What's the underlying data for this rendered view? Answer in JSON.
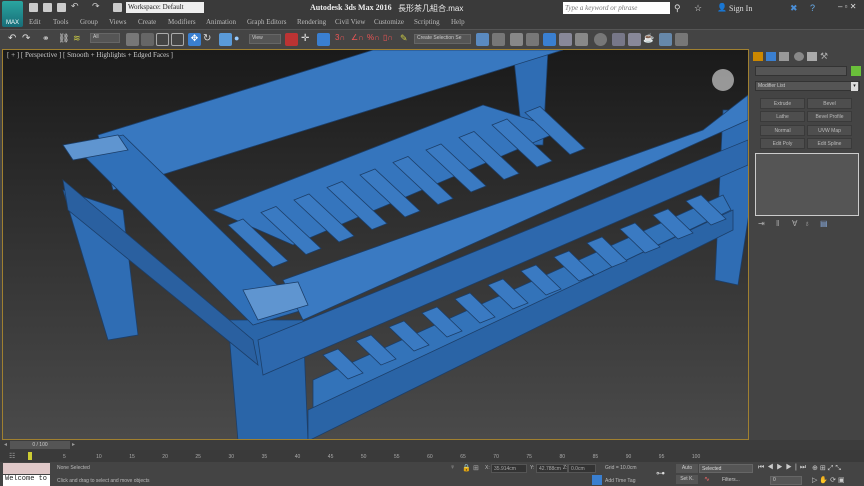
{
  "title": {
    "app": "Autodesk 3ds Max 2016",
    "file": "長形茶几組合.max",
    "workspace": "Workspace: Default",
    "search_placeholder": "Type a keyword or phrase",
    "sign_in": "Sign In",
    "logo": "MAX"
  },
  "menu": [
    "Edit",
    "Tools",
    "Group",
    "Views",
    "Create",
    "Modifiers",
    "Animation",
    "Graph Editors",
    "Rendering",
    "Civil View",
    "Customize",
    "Scripting",
    "Help"
  ],
  "toolbar": {
    "filter": "All",
    "ref_coord": "View",
    "selection_set": "Create Selection Se"
  },
  "viewport": {
    "label": "[ + ] [ Perspective ] [ Smooth + Highlights + Edged Faces ]"
  },
  "command_panel": {
    "modifier_list": "Modifier List",
    "color": "#6abf3a",
    "buttons": [
      "Extrude",
      "Bevel",
      "Lathe",
      "Bevel Profile",
      "Normal",
      "UVW Map",
      "Edit Poly",
      "Edit Spline"
    ]
  },
  "timeline": {
    "frame": "0 / 100",
    "ticks": [
      "5",
      "10",
      "15",
      "20",
      "25",
      "30",
      "35",
      "40",
      "45",
      "50",
      "55",
      "60",
      "65",
      "70",
      "75",
      "80",
      "85",
      "90",
      "95",
      "100"
    ]
  },
  "status": {
    "maxscript": "Welcome to",
    "selection": "None Selected",
    "prompt": "Click and drag to select and move objects",
    "x": "35.914cm",
    "y": "42.788cm",
    "z": "0.0cm",
    "grid": "Grid = 10.0cm",
    "add_time_tag": "Add Time Tag",
    "auto_key": "Auto",
    "set_key": "Set K.",
    "key_filter": "Selected",
    "filters": "Filters...",
    "frame_field": "0"
  }
}
